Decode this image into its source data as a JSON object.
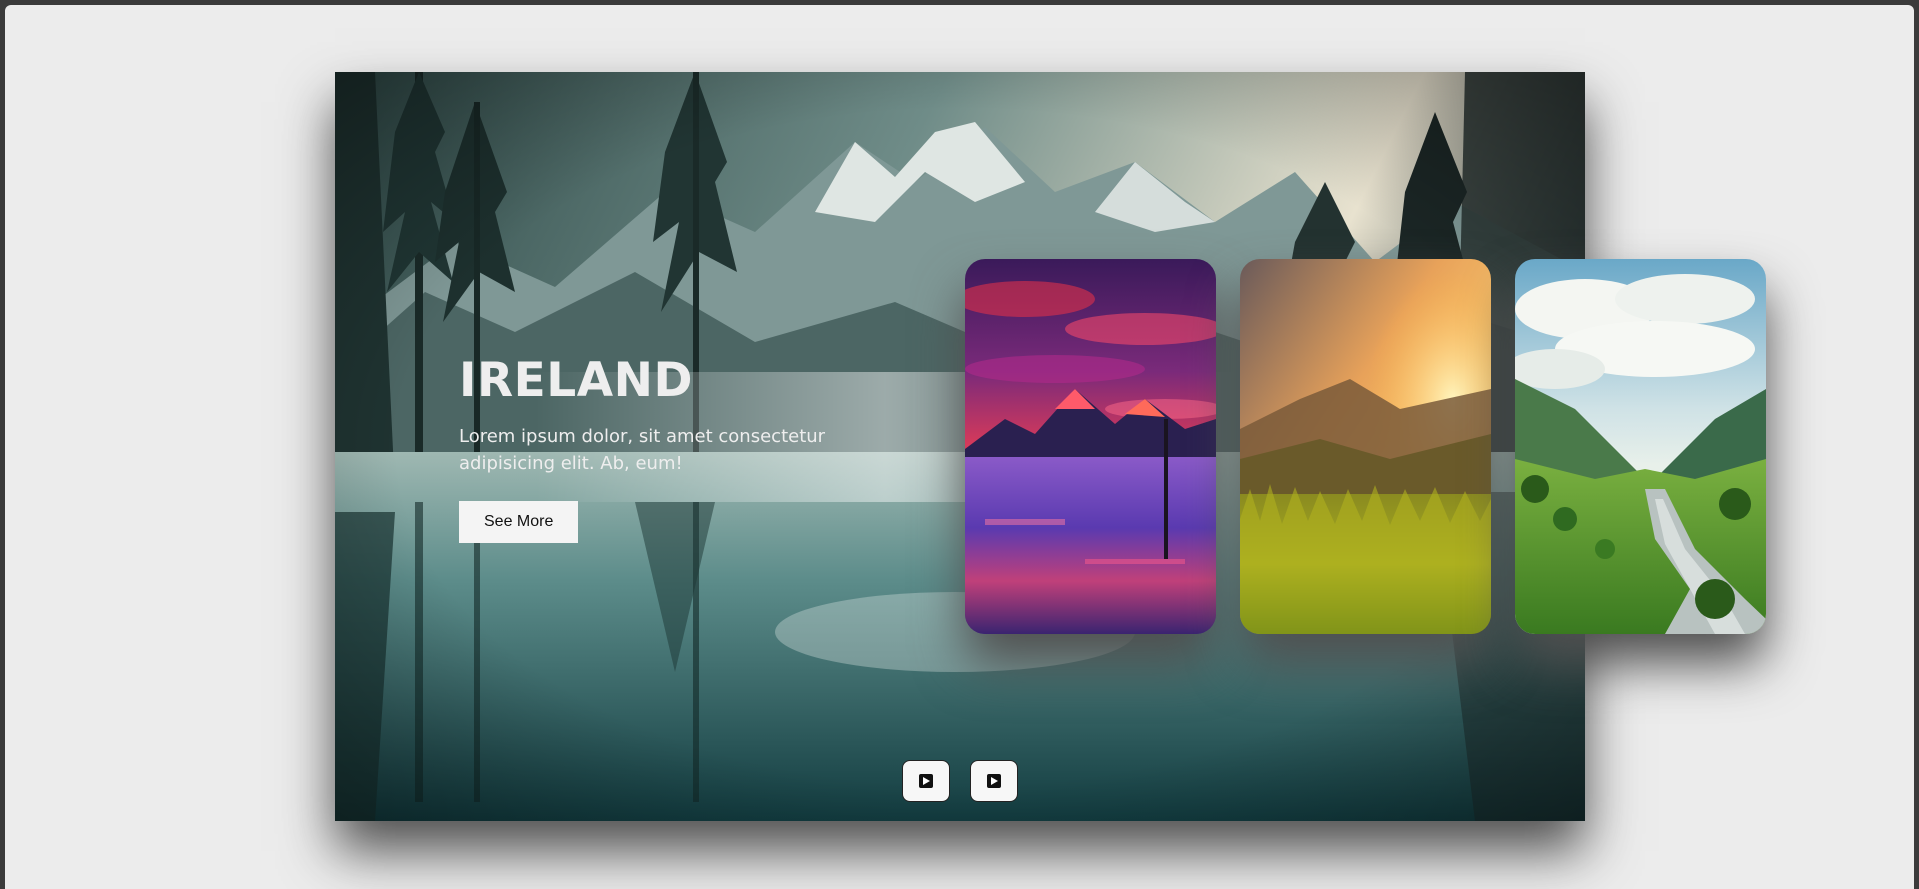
{
  "slider": {
    "active": {
      "name": "IRELAND",
      "description": "Lorem ipsum dolor, sit amet consectetur adipisicing elit. Ab, eum!",
      "button_label": "See More",
      "image": "mountain-lake-forest-landscape"
    },
    "thumbnails": [
      {
        "image": "purple-sunset-lake-mountains"
      },
      {
        "image": "golden-sunrise-meadow"
      },
      {
        "image": "green-valley-river-clouds"
      }
    ]
  },
  "controls": {
    "prev_icon": "play-square-icon",
    "next_icon": "play-square-icon"
  }
}
